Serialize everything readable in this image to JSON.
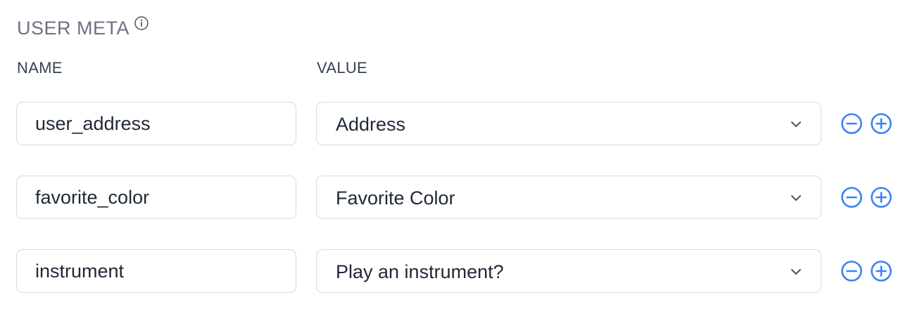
{
  "section": {
    "title": "USER META",
    "info_icon": "info-icon"
  },
  "columns": {
    "name": "NAME",
    "value": "VALUE"
  },
  "rows": [
    {
      "name": "user_address",
      "value": "Address"
    },
    {
      "name": "favorite_color",
      "value": "Favorite Color"
    },
    {
      "name": "instrument",
      "value": "Play an instrument?"
    }
  ],
  "icons": {
    "remove": "minus-circle-icon",
    "add": "plus-circle-icon",
    "dropdown": "chevron-down-icon"
  },
  "colors": {
    "accent": "#3b82f6",
    "border": "#d6d9de",
    "title": "#6b7280",
    "text": "#1f2937"
  }
}
